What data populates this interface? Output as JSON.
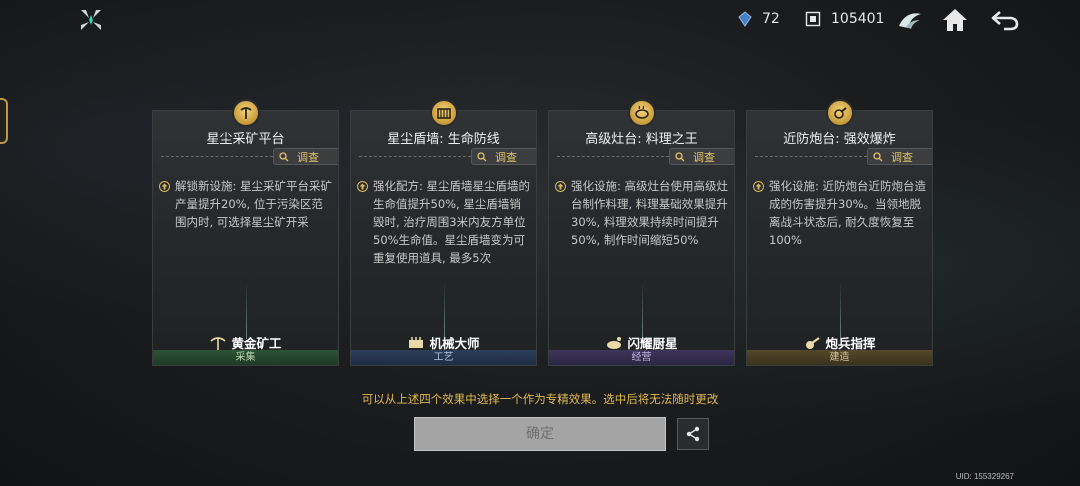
{
  "topbar": {
    "gem_count": "72",
    "coin_count": "105401",
    "icons": [
      "app-logo-icon",
      "gem-icon",
      "coin-icon",
      "faction-icon",
      "home-icon",
      "back-icon"
    ]
  },
  "cards": [
    {
      "title": "星尘采矿平台",
      "investigate_label": "调查",
      "desc": "解锁新设施: 星尘采矿平台采矿产量提升20%, 位于污染区范围内时, 可选择星尘矿开采",
      "role": "黄金矿工",
      "category": "采集",
      "category_color": "#2e5236"
    },
    {
      "title": "星尘盾墙: 生命防线",
      "investigate_label": "调查",
      "desc": "强化配方: 星尘盾墙星尘盾墙的生命值提升50%, 星尘盾墙销毁时, 治疗周围3米内友方单位50%生命值。星尘盾墙变为可重复使用道具, 最多5次",
      "role": "机械大师",
      "category": "工艺",
      "category_color": "#2c3f5a"
    },
    {
      "title": "高级灶台: 料理之王",
      "investigate_label": "调查",
      "desc": "强化设施: 高级灶台使用高级灶台制作料理, 料理基础效果提升30%, 料理效果持续时间提升50%, 制作时间缩短50%",
      "role": "闪耀厨星",
      "category": "经营",
      "category_color": "#3d355a"
    },
    {
      "title": "近防炮台: 强效爆炸",
      "investigate_label": "调查",
      "desc": "强化设施: 近防炮台近防炮台造成的伤害提升30%。当领地脱离战斗状态后, 耐久度恢复至100%",
      "role": "炮兵指挥",
      "category": "建造",
      "category_color": "#54482a"
    }
  ],
  "hint_text": "可以从上述四个效果中选择一个作为专精效果。选中后将无法随时更改",
  "confirm_label": "确定",
  "uid_text": "UID: 155329267",
  "colors": {
    "accent_gold": "#e0b94f",
    "text": "#d8d8d8"
  }
}
